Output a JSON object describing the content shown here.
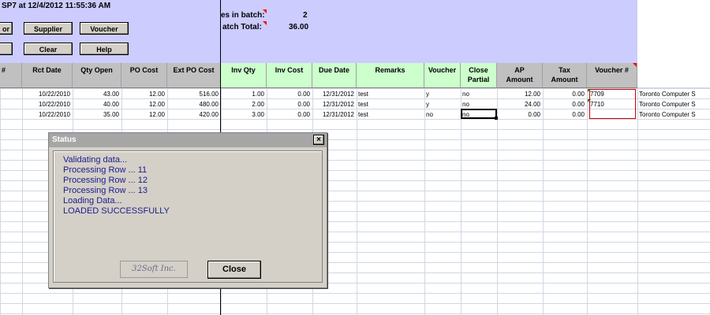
{
  "header": {
    "title": "SP7 at 12/4/2012 11:55:36 AM",
    "lines_label": "es in batch:",
    "lines_value": "2",
    "total_label": "atch Total:",
    "total_value": "36.00"
  },
  "toolbar": {
    "btn_or": "or",
    "btn_supplier": "Supplier",
    "btn_voucher": "Voucher",
    "btn_clear": "Clear",
    "btn_help": "Help"
  },
  "columns": {
    "hash": "#",
    "rct_date": "Rct Date",
    "qty_open": "Qty Open",
    "po_cost": "PO Cost",
    "ext_po_cost": "Ext PO Cost",
    "inv_qty": "Inv Qty",
    "inv_cost": "Inv Cost",
    "due_date": "Due Date",
    "remarks": "Remarks",
    "voucher": "Voucher",
    "close_partial_1": "Close",
    "close_partial_2": "Partial",
    "ap_amount_1": "AP",
    "ap_amount_2": "Amount",
    "tax_amount_1": "Tax",
    "tax_amount_2": "Amount",
    "voucher_no": "Voucher #"
  },
  "rows": [
    {
      "rct_date": "10/22/2010",
      "qty_open": "43.00",
      "po_cost": "12.00",
      "ext_po_cost": "516.00",
      "inv_qty": "1.00",
      "inv_cost": "0.00",
      "due_date": "12/31/2012",
      "remarks": "test",
      "voucher": "y",
      "close_partial": "no",
      "ap_amount": "12.00",
      "tax_amount": "0.00",
      "voucher_no": "7709",
      "vendor": "Toronto Computer S"
    },
    {
      "rct_date": "10/22/2010",
      "qty_open": "40.00",
      "po_cost": "12.00",
      "ext_po_cost": "480.00",
      "inv_qty": "2.00",
      "inv_cost": "0.00",
      "due_date": "12/31/2012",
      "remarks": "test",
      "voucher": "y",
      "close_partial": "no",
      "ap_amount": "24.00",
      "tax_amount": "0.00",
      "voucher_no": "7710",
      "vendor": "Toronto Computer S"
    },
    {
      "rct_date": "10/22/2010",
      "qty_open": "35.00",
      "po_cost": "12.00",
      "ext_po_cost": "420.00",
      "inv_qty": "3.00",
      "inv_cost": "0.00",
      "due_date": "12/31/2012",
      "remarks": "test",
      "voucher": "no",
      "close_partial": "no",
      "ap_amount": "0.00",
      "tax_amount": "0.00",
      "voucher_no": "",
      "vendor": "Toronto Computer S"
    }
  ],
  "dialog": {
    "title": "Status",
    "close_x": "×",
    "messages": [
      "Validating data...",
      "Processing Row ... 11",
      "Processing Row ... 12",
      "Processing Row ... 13",
      "Loading Data...",
      "LOADED SUCCESSFULLY"
    ],
    "brand": "32Soft Inc.",
    "close_label": "Close"
  }
}
